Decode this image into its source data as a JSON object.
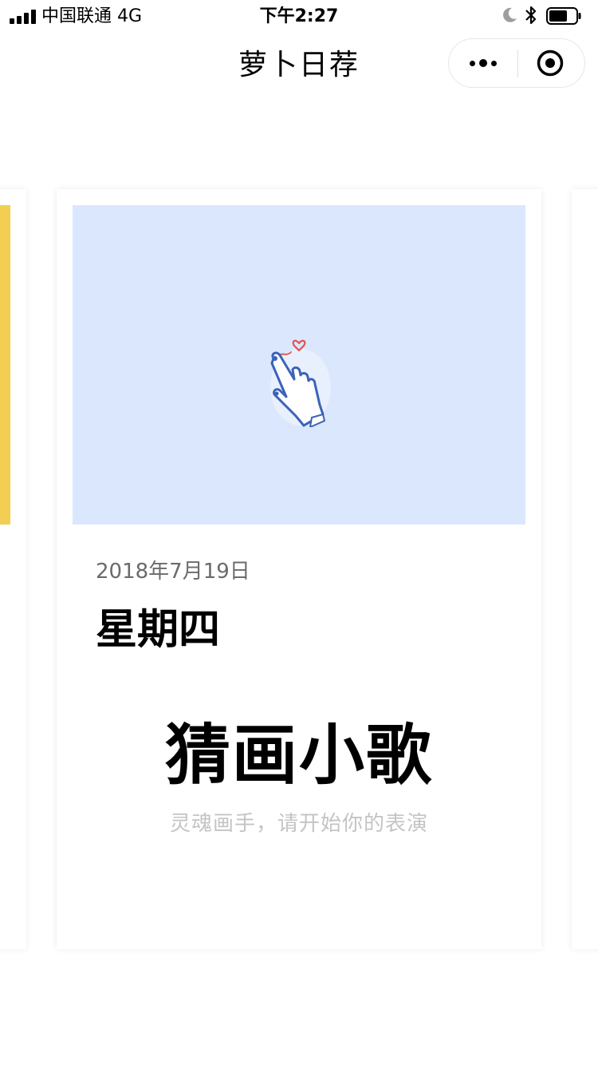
{
  "status_bar": {
    "carrier": "中国联通   4G",
    "time": "下午2:27"
  },
  "nav": {
    "title": "萝卜日荐"
  },
  "card": {
    "date": "2018年7月19日",
    "weekday": "星期四",
    "title": "猜画小歌",
    "subtitle": "灵魂画手，请开始你的表演",
    "image_bg": "#dbe7fd"
  },
  "side_cards": {
    "left_accent": "#f2cf52"
  },
  "icons": {
    "signal": "cellular-signal-icon",
    "moon": "do-not-disturb-moon-icon",
    "bluetooth": "bluetooth-icon",
    "battery": "battery-icon",
    "more": "more-dots-icon",
    "close": "close-target-icon",
    "hand": "hand-heart-icon"
  }
}
